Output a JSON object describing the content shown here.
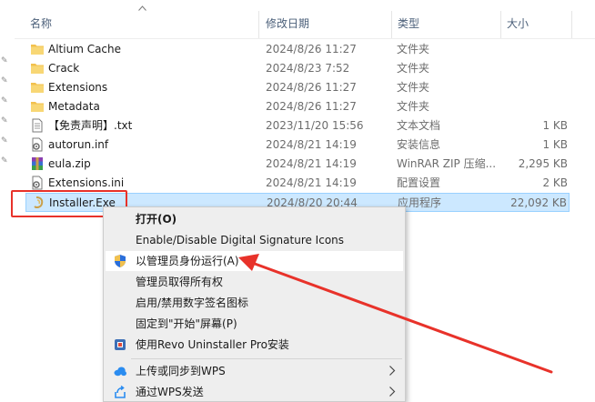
{
  "headers": {
    "name": "名称",
    "date": "修改日期",
    "type": "类型",
    "size": "大小"
  },
  "files": [
    {
      "name": "Altium Cache",
      "date": "2024/8/26 11:27",
      "type": "文件夹",
      "size": "",
      "icon": "folder-icon"
    },
    {
      "name": "Crack",
      "date": "2024/8/23 7:52",
      "type": "文件夹",
      "size": "",
      "icon": "folder-icon"
    },
    {
      "name": "Extensions",
      "date": "2024/8/26 11:27",
      "type": "文件夹",
      "size": "",
      "icon": "folder-icon"
    },
    {
      "name": "Metadata",
      "date": "2024/8/26 11:27",
      "type": "文件夹",
      "size": "",
      "icon": "folder-icon"
    },
    {
      "name": "【免责声明】.txt",
      "date": "2023/11/20 15:56",
      "type": "文本文档",
      "size": "1 KB",
      "icon": "text-file-icon"
    },
    {
      "name": "autorun.inf",
      "date": "2024/8/21 14:19",
      "type": "安装信息",
      "size": "1 KB",
      "icon": "settings-file-icon"
    },
    {
      "name": "eula.zip",
      "date": "2024/8/21 14:19",
      "type": "WinRAR ZIP 压缩...",
      "size": "2,295 KB",
      "icon": "winrar-archive-icon"
    },
    {
      "name": "Extensions.ini",
      "date": "2024/8/21 14:19",
      "type": "配置设置",
      "size": "2 KB",
      "icon": "settings-file-icon"
    },
    {
      "name": "Installer.Exe",
      "date": "2024/8/20 20:44",
      "type": "应用程序",
      "size": "22,092 KB",
      "icon": "installer-app-icon"
    }
  ],
  "context_menu": {
    "items": [
      {
        "label": "打开(O)",
        "bold": true,
        "icon": "",
        "submenu": false
      },
      {
        "label": "Enable/Disable Digital Signature Icons",
        "bold": false,
        "icon": "",
        "submenu": false
      },
      {
        "label": "以管理员身份运行(A)",
        "bold": false,
        "icon": "uac-shield-icon",
        "submenu": false
      },
      {
        "label": "管理员取得所有权",
        "bold": false,
        "icon": "",
        "submenu": false
      },
      {
        "label": "启用/禁用数字签名图标",
        "bold": false,
        "icon": "",
        "submenu": false
      },
      {
        "label": "固定到\"开始\"屏幕(P)",
        "bold": false,
        "icon": "",
        "submenu": false
      },
      {
        "label": "使用Revo Uninstaller Pro安装",
        "bold": false,
        "icon": "revo-uninstaller-icon",
        "submenu": false
      },
      {
        "label": "上传或同步到WPS",
        "bold": false,
        "icon": "wps-cloud-icon",
        "submenu": true
      },
      {
        "label": "通过WPS发送",
        "bold": false,
        "icon": "wps-share-icon",
        "submenu": true
      }
    ]
  },
  "colors": {
    "selection": "#cce8ff",
    "callout": "#e8322a",
    "folder": "#f2c14e"
  }
}
